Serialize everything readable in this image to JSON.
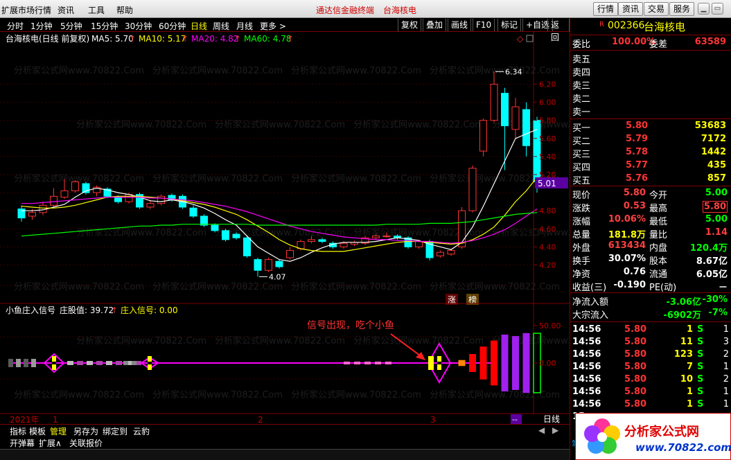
{
  "menubar": {
    "items": [
      "扩展市场行情",
      "资讯",
      "工具",
      "帮助"
    ],
    "title_app": "通达信金融终端",
    "title_stock": "台海核电",
    "right_buttons": [
      "行情",
      "资讯",
      "交易",
      "服务"
    ]
  },
  "periods": [
    "分时",
    "1分钟",
    "5分钟",
    "15分钟",
    "30分钟",
    "60分钟",
    "日线",
    "周线",
    "月线",
    "更多 >"
  ],
  "active_period": "日线",
  "toolbar": [
    "复权",
    "叠加",
    "画线",
    "F10",
    "标记",
    "+自选",
    "返回"
  ],
  "main_chart": {
    "legend_name": "台海核电(日线 前复权)",
    "ma": [
      {
        "label": "MA5: 5.70",
        "arrow": "↑",
        "color": "#ffffff"
      },
      {
        "label": "MA10: 5.17",
        "arrow": "↑",
        "color": "#ffff00"
      },
      {
        "label": "MA20: 4.82",
        "arrow": "↑",
        "color": "#ff00ff"
      },
      {
        "label": "MA60: 4.78",
        "arrow": "↑",
        "color": "#00ff00"
      }
    ],
    "high_label": "6.34",
    "low_label": "4.07",
    "current_price_tag": "5.01",
    "y_ticks": [
      "6.20",
      "6.00",
      "5.80",
      "5.60",
      "5.40",
      "5.20",
      "4.80",
      "4.60",
      "4.40",
      "4.20"
    ],
    "badges": [
      "涨",
      "榜"
    ]
  },
  "indicator": {
    "name": "小鱼庄入信号",
    "field1": "庄股值: 39.72",
    "field1_arrow": "↑",
    "field2": "庄入信号: 0.00",
    "annotation": "信号出现，吃个小鱼",
    "y_ticks": [
      "50.00",
      "0.00"
    ]
  },
  "x_axis": {
    "labels": [
      "2021年",
      "1",
      "2",
      "3"
    ],
    "cycle": "日线",
    "extra": "--"
  },
  "watermarks": [
    "分析家公式网www.70822.Com"
  ],
  "bottom_tabs": [
    "指标",
    "模板",
    "管理",
    "另存为",
    "绑定到",
    "云豹"
  ],
  "active_bottom_tab": "管理",
  "bottom_tabs2": [
    "开弹幕",
    "扩展∧",
    "关联报价"
  ],
  "quote": {
    "tag": "R",
    "code": "002366",
    "name": "台海核电",
    "weibi_label": "委比",
    "weibi_value": "100.00%",
    "weicha_label": "委差",
    "weicha_value": "63589",
    "sell_levels": [
      "卖五",
      "卖四",
      "卖三",
      "卖二",
      "卖一"
    ],
    "buy_levels": [
      {
        "label": "买一",
        "price": "5.80",
        "vol": "53683"
      },
      {
        "label": "买二",
        "price": "5.79",
        "vol": "7172"
      },
      {
        "label": "买三",
        "price": "5.78",
        "vol": "1442"
      },
      {
        "label": "买四",
        "price": "5.77",
        "vol": "435"
      },
      {
        "label": "买五",
        "price": "5.76",
        "vol": "857"
      }
    ],
    "stats": [
      {
        "l1": "现价",
        "v1": "5.80",
        "c1": "#ff4040",
        "l2": "今开",
        "v2": "5.00",
        "c2": "#00ff00"
      },
      {
        "l1": "涨跌",
        "v1": "0.53",
        "c1": "#ff4040",
        "l2": "最高",
        "v2": "5.80",
        "c2": "#ff4040",
        "box2": true
      },
      {
        "l1": "涨幅",
        "v1": "10.06%",
        "c1": "#ff4040",
        "l2": "最低",
        "v2": "5.00",
        "c2": "#00ff00"
      },
      {
        "l1": "总量",
        "v1": "181.8万",
        "c1": "#ffff00",
        "l2": "量比",
        "v2": "1.14",
        "c2": "#ff4040"
      },
      {
        "l1": "外盘",
        "v1": "613434",
        "c1": "#ff4040",
        "l2": "内盘",
        "v2": "120.4万",
        "c2": "#00ff00"
      },
      {
        "l1": "换手",
        "v1": "30.07%",
        "c1": "#ffffff",
        "l2": "股本",
        "v2": "8.67亿",
        "c2": "#ffffff"
      },
      {
        "l1": "净资",
        "v1": "0.76",
        "c1": "#ffffff",
        "l2": "流通",
        "v2": "6.05亿",
        "c2": "#ffffff"
      },
      {
        "l1": "收益(三)",
        "v1": "-0.190",
        "c1": "#ffffff",
        "l2": "PE(动)",
        "v2": "－",
        "c2": "#ffffff"
      }
    ],
    "flow": [
      {
        "label": "净流入额",
        "v1": "-3.06亿",
        "v2": "-30%"
      },
      {
        "label": "大宗流入",
        "v1": "-6902万",
        "v2": "-7%"
      }
    ],
    "ticks": [
      {
        "time": "14:56",
        "price": "5.80",
        "vol": "1",
        "bs": "S",
        "n": "1"
      },
      {
        "time": "14:56",
        "price": "5.80",
        "vol": "11",
        "bs": "S",
        "n": "3"
      },
      {
        "time": "14:56",
        "price": "5.80",
        "vol": "123",
        "bs": "S",
        "n": "2"
      },
      {
        "time": "14:56",
        "price": "5.80",
        "vol": "7",
        "bs": "S",
        "n": "1"
      },
      {
        "time": "14:56",
        "price": "5.80",
        "vol": "10",
        "bs": "S",
        "n": "2"
      },
      {
        "time": "14:56",
        "price": "5.80",
        "vol": "1",
        "bs": "S",
        "n": "1"
      },
      {
        "time": "14:56",
        "price": "5.80",
        "vol": "1",
        "bs": "S",
        "n": "1"
      },
      {
        "time": "15",
        "price": "",
        "vol": "",
        "bs": "",
        "n": ""
      }
    ],
    "side_label": "笔"
  },
  "logo": {
    "text": "分析家公式网",
    "url": "www.70822.com"
  },
  "colors": {
    "up": "#ff3333",
    "down": "#00ffff",
    "grid": "#800000",
    "bg": "#000000"
  },
  "chart_data": {
    "type": "candlestick",
    "candles": [
      [
        4.82,
        4.72,
        4.86,
        4.68
      ],
      [
        4.74,
        4.78,
        4.82,
        4.7
      ],
      [
        4.78,
        4.86,
        4.9,
        4.75
      ],
      [
        4.86,
        4.96,
        5.05,
        4.84
      ],
      [
        4.95,
        5.02,
        5.15,
        4.93
      ],
      [
        5.02,
        5.12,
        5.14,
        5.0
      ],
      [
        5.1,
        5.0,
        5.12,
        4.98
      ],
      [
        5.0,
        5.06,
        5.08,
        4.96
      ],
      [
        5.04,
        4.96,
        5.06,
        4.94
      ],
      [
        4.95,
        4.9,
        4.97,
        4.88
      ],
      [
        4.9,
        4.98,
        5.0,
        4.88
      ],
      [
        4.98,
        4.84,
        5.0,
        4.82
      ],
      [
        4.84,
        4.88,
        4.92,
        4.82
      ],
      [
        4.88,
        4.96,
        4.98,
        4.86
      ],
      [
        4.97,
        4.92,
        4.99,
        4.9
      ],
      [
        4.96,
        4.84,
        4.98,
        4.82
      ],
      [
        4.83,
        4.74,
        4.86,
        4.72
      ],
      [
        4.74,
        4.64,
        4.76,
        4.62
      ],
      [
        4.64,
        4.58,
        4.66,
        4.56
      ],
      [
        4.58,
        4.48,
        4.6,
        4.46
      ],
      [
        4.54,
        4.5,
        4.56,
        4.48
      ],
      [
        4.5,
        4.3,
        4.52,
        4.28
      ],
      [
        4.26,
        4.14,
        4.28,
        4.07
      ],
      [
        4.14,
        4.26,
        4.28,
        4.12
      ],
      [
        4.24,
        4.18,
        4.26,
        4.16
      ],
      [
        4.28,
        4.36,
        4.4,
        4.26
      ],
      [
        4.38,
        4.46,
        4.48,
        4.36
      ],
      [
        4.46,
        4.48,
        4.52,
        4.44
      ],
      [
        4.48,
        4.46,
        4.5,
        4.44
      ],
      [
        4.44,
        4.4,
        4.46,
        4.38
      ],
      [
        4.4,
        4.44,
        4.46,
        4.38
      ],
      [
        4.43,
        4.45,
        4.47,
        4.41
      ],
      [
        4.44,
        4.5,
        4.52,
        4.42
      ],
      [
        4.5,
        4.52,
        4.54,
        4.48
      ],
      [
        4.52,
        4.52,
        4.56,
        4.5
      ],
      [
        4.52,
        4.5,
        4.54,
        4.48
      ],
      [
        4.5,
        4.4,
        4.52,
        4.38
      ],
      [
        4.4,
        4.46,
        4.48,
        4.38
      ],
      [
        4.46,
        4.28,
        4.48,
        4.25
      ],
      [
        4.3,
        4.34,
        4.36,
        4.28
      ],
      [
        4.32,
        4.36,
        4.38,
        4.3
      ],
      [
        4.4,
        4.8,
        4.84,
        4.38
      ],
      [
        4.8,
        5.27,
        5.3,
        4.78
      ],
      [
        5.46,
        5.8,
        5.82,
        5.4
      ],
      [
        5.8,
        6.2,
        6.34,
        5.78
      ],
      [
        6.1,
        5.74,
        6.16,
        5.25
      ],
      [
        5.7,
        5.95,
        6.05,
        5.6
      ],
      [
        5.92,
        5.52,
        6.0,
        5.4
      ],
      [
        5.8,
        5.12,
        5.84,
        5.0
      ]
    ],
    "ma": {
      "MA5": {
        "color": "#ffffff",
        "values": [
          4.8,
          4.8,
          4.81,
          4.84,
          4.87,
          4.95,
          5.02,
          5.05,
          5.03,
          5.0,
          4.98,
          4.95,
          4.91,
          4.9,
          4.92,
          4.9,
          4.87,
          4.83,
          4.77,
          4.7,
          4.64,
          4.52,
          4.4,
          4.33,
          4.26,
          4.24,
          4.28,
          4.34,
          4.39,
          4.43,
          4.45,
          4.45,
          4.45,
          4.46,
          4.48,
          4.5,
          4.49,
          4.47,
          4.43,
          4.4,
          4.37,
          4.45,
          4.62,
          4.85,
          5.1,
          5.35,
          5.6,
          5.65,
          5.7
        ]
      },
      "MA10": {
        "color": "#ffff00",
        "values": [
          4.85,
          4.84,
          4.83,
          4.83,
          4.84,
          4.86,
          4.89,
          4.92,
          4.95,
          4.96,
          4.96,
          4.96,
          4.95,
          4.94,
          4.93,
          4.91,
          4.89,
          4.87,
          4.84,
          4.8,
          4.76,
          4.7,
          4.63,
          4.56,
          4.48,
          4.42,
          4.38,
          4.36,
          4.35,
          4.35,
          4.35,
          4.37,
          4.39,
          4.41,
          4.43,
          4.45,
          4.46,
          4.46,
          4.45,
          4.44,
          4.43,
          4.44,
          4.48,
          4.54,
          4.62,
          4.75,
          4.9,
          5.02,
          5.17
        ]
      },
      "MA20": {
        "color": "#ff00ff",
        "values": [
          4.88,
          4.88,
          4.89,
          4.9,
          4.91,
          4.92,
          4.93,
          4.94,
          4.95,
          4.95,
          4.95,
          4.95,
          4.94,
          4.94,
          4.93,
          4.92,
          4.91,
          4.89,
          4.87,
          4.85,
          4.82,
          4.79,
          4.75,
          4.71,
          4.67,
          4.63,
          4.6,
          4.57,
          4.55,
          4.53,
          4.51,
          4.5,
          4.49,
          4.48,
          4.48,
          4.47,
          4.47,
          4.46,
          4.46,
          4.45,
          4.44,
          4.45,
          4.47,
          4.5,
          4.54,
          4.59,
          4.66,
          4.74,
          4.82
        ]
      },
      "MA60": {
        "color": "#00ff00",
        "values": [
          4.52,
          4.53,
          4.54,
          4.55,
          4.56,
          4.57,
          4.58,
          4.59,
          4.6,
          4.61,
          4.62,
          4.63,
          4.63,
          4.64,
          4.64,
          4.65,
          4.65,
          4.65,
          4.65,
          4.65,
          4.65,
          4.65,
          4.64,
          4.64,
          4.64,
          4.64,
          4.64,
          4.64,
          4.64,
          4.64,
          4.64,
          4.64,
          4.64,
          4.64,
          4.65,
          4.65,
          4.65,
          4.65,
          4.66,
          4.66,
          4.66,
          4.67,
          4.68,
          4.7,
          4.72,
          4.74,
          4.76,
          4.77,
          4.78
        ]
      }
    },
    "ylim": [
      4.05,
      6.35
    ],
    "indicator_bars": {
      "indices": [
        41,
        42,
        43,
        44,
        45,
        46,
        47,
        48
      ],
      "values": [
        4,
        12,
        22,
        30,
        38,
        36,
        40,
        39.72
      ],
      "colors": [
        "#ff8800",
        "#ff0000",
        "#ff0000",
        "#ff0000",
        "#a020f0",
        "#a020f0",
        "#a020f0",
        "#00ff00"
      ]
    },
    "indicator_ylim": [
      -40,
      60
    ]
  }
}
